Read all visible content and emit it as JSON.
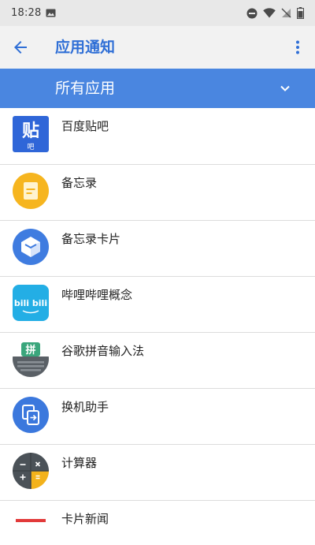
{
  "status_bar": {
    "time": "18:28"
  },
  "app_bar": {
    "title": "应用通知"
  },
  "filter": {
    "label": "所有应用"
  },
  "apps": [
    {
      "name": "百度贴吧",
      "icon": "tieba-icon"
    },
    {
      "name": "备忘录",
      "icon": "memo-icon"
    },
    {
      "name": "备忘录卡片",
      "icon": "memo-card-icon"
    },
    {
      "name": "哔哩哔哩概念",
      "icon": "bilibili-icon"
    },
    {
      "name": "谷歌拼音输入法",
      "icon": "google-pinyin-icon"
    },
    {
      "name": "换机助手",
      "icon": "phone-clone-icon"
    },
    {
      "name": "计算器",
      "icon": "calculator-icon"
    },
    {
      "name": "卡片新闻",
      "icon": "news-icon"
    }
  ],
  "icon_glyphs": {
    "tieba_main": "贴",
    "tieba_sub": "吧",
    "bili": "bili bili",
    "pinyin": "拼"
  },
  "colors": {
    "accent": "#2f6fd6",
    "filter_bar": "#4a86e0",
    "status_bar": "#e8e8e8",
    "app_bar": "#f2f2f2"
  }
}
